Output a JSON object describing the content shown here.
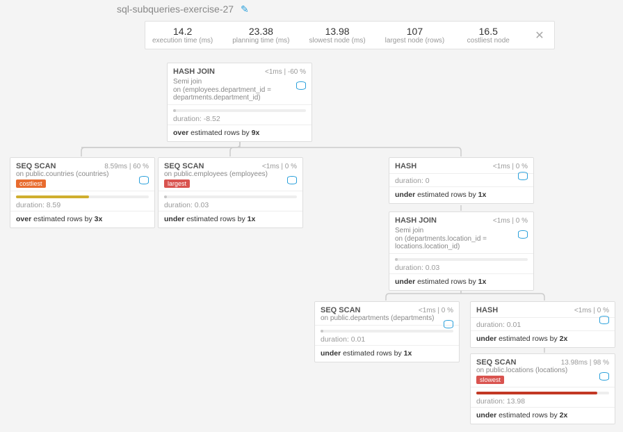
{
  "title": "sql-subqueries-exercise-27",
  "stats": {
    "exec": {
      "v": "14.2",
      "l": "execution time (ms)"
    },
    "plan": {
      "v": "23.38",
      "l": "planning time (ms)"
    },
    "slow": {
      "v": "13.98",
      "l": "slowest node (ms)"
    },
    "large": {
      "v": "107",
      "l": "largest node (rows)"
    },
    "cost": {
      "v": "16.5",
      "l": "costliest node"
    }
  },
  "n_root": {
    "name": "HASH JOIN",
    "t": "<1ms",
    "p": "-60 %",
    "sub": "Semi join",
    "on": "on (employees.department_id = departments.department_id)",
    "dur": "duration: -8.52",
    "est_pre": "over",
    "est": " estimated rows by ",
    "est_fac": "9x",
    "bar_w": "2%",
    "bar_c": "#c7c7c7"
  },
  "n_countries": {
    "name": "SEQ SCAN",
    "t": "8.59ms",
    "p": "60 %",
    "on": "on public.countries (countries)",
    "badge": "costliest",
    "dur": "duration: 8.59",
    "est_pre": "over",
    "est": " estimated rows by ",
    "est_fac": "3x",
    "bar_w": "55%",
    "bar_c": "#cfae2f"
  },
  "n_employees": {
    "name": "SEQ SCAN",
    "t": "<1ms",
    "p": "0 %",
    "on": "on public.employees (employees)",
    "badge": "largest",
    "dur": "duration: 0.03",
    "est_pre": "under",
    "est": " estimated rows by ",
    "est_fac": "1x",
    "bar_w": "2%",
    "bar_c": "#c7c7c7"
  },
  "n_hash1": {
    "name": "HASH",
    "t": "<1ms",
    "p": "0 %",
    "dur": "duration: 0",
    "est_pre": "under",
    "est": " estimated rows by ",
    "est_fac": "1x",
    "bar_w": "0%",
    "bar_c": "#c7c7c7"
  },
  "n_hj2": {
    "name": "HASH JOIN",
    "t": "<1ms",
    "p": "0 %",
    "sub": "Semi join",
    "on": "on (departments.location_id = locations.location_id)",
    "dur": "duration: 0.03",
    "est_pre": "under",
    "est": " estimated rows by ",
    "est_fac": "1x",
    "bar_w": "2%",
    "bar_c": "#c7c7c7"
  },
  "n_dept": {
    "name": "SEQ SCAN",
    "t": "<1ms",
    "p": "0 %",
    "on": "on public.departments (departments)",
    "dur": "duration: 0.01",
    "est_pre": "under",
    "est": " estimated rows by ",
    "est_fac": "1x",
    "bar_w": "2%",
    "bar_c": "#c7c7c7"
  },
  "n_hash2": {
    "name": "HASH",
    "t": "<1ms",
    "p": "0 %",
    "dur": "duration: 0.01",
    "est_pre": "under",
    "est": " estimated rows by ",
    "est_fac": "2x",
    "bar_w": "0%",
    "bar_c": "#c7c7c7"
  },
  "n_loc": {
    "name": "SEQ SCAN",
    "t": "13.98ms",
    "p": "98 %",
    "on": "on public.locations (locations)",
    "badge": "slowest",
    "dur": "duration: 13.98",
    "est_pre": "under",
    "est": " estimated rows by ",
    "est_fac": "2x",
    "bar_w": "91%",
    "bar_c": "#c23824"
  }
}
